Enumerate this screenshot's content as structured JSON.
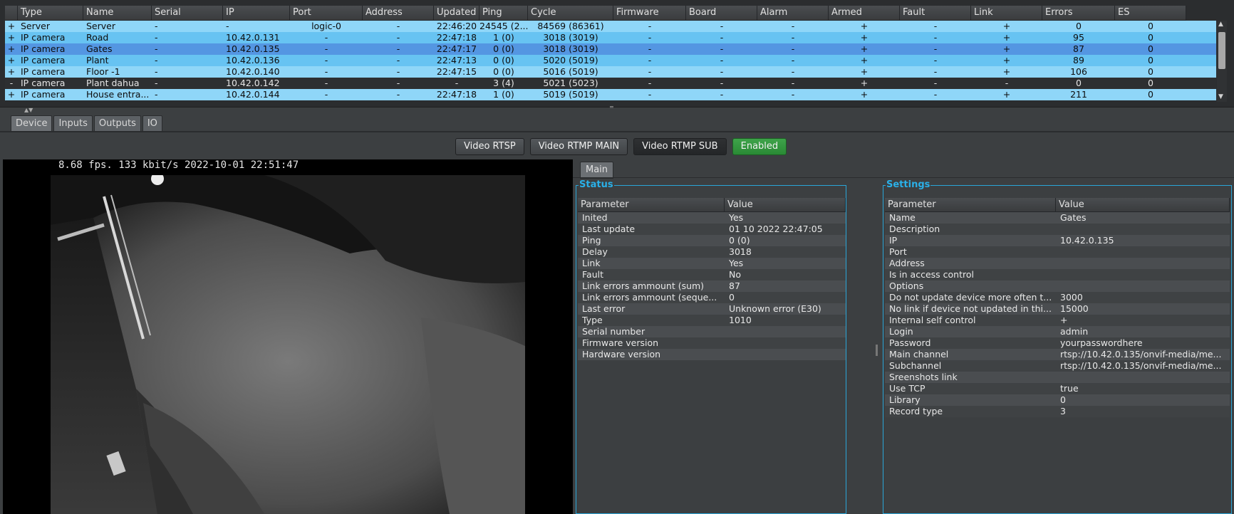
{
  "device_table": {
    "columns": [
      "",
      "Type",
      "Name",
      "Serial",
      "IP",
      "Port",
      "Address",
      "Updated",
      "Ping",
      "Cycle",
      "Firmware",
      "Board",
      "Alarm",
      "Armed",
      "Fault",
      "Link",
      "Errors",
      "ES"
    ],
    "rows": [
      {
        "exp": "+",
        "type": "Server",
        "name": "Server",
        "serial": "-",
        "ip": "-",
        "port": "logic-0",
        "address": "-",
        "updated": "22:46:20",
        "ping": "24545 (2...",
        "cycle": "84569 (86361)",
        "firmware": "-",
        "board": "-",
        "alarm": "-",
        "armed": "+",
        "fault": "-",
        "link": "+",
        "errors": "0",
        "es": "0"
      },
      {
        "exp": "+",
        "type": "IP camera",
        "name": "Road",
        "serial": "-",
        "ip": "10.42.0.131",
        "port": "-",
        "address": "-",
        "updated": "22:47:18",
        "ping": "1 (0)",
        "cycle": "3018 (3019)",
        "firmware": "-",
        "board": "-",
        "alarm": "-",
        "armed": "+",
        "fault": "-",
        "link": "+",
        "errors": "95",
        "es": "0"
      },
      {
        "exp": "+",
        "type": "IP camera",
        "name": "Gates",
        "serial": "-",
        "ip": "10.42.0.135",
        "port": "-",
        "address": "-",
        "updated": "22:47:17",
        "ping": "0 (0)",
        "cycle": "3018 (3019)",
        "firmware": "-",
        "board": "-",
        "alarm": "-",
        "armed": "+",
        "fault": "-",
        "link": "+",
        "errors": "87",
        "es": "0"
      },
      {
        "exp": "+",
        "type": "IP camera",
        "name": "Plant",
        "serial": "-",
        "ip": "10.42.0.136",
        "port": "-",
        "address": "-",
        "updated": "22:47:13",
        "ping": "0 (0)",
        "cycle": "5020 (5019)",
        "firmware": "-",
        "board": "-",
        "alarm": "-",
        "armed": "+",
        "fault": "-",
        "link": "+",
        "errors": "89",
        "es": "0"
      },
      {
        "exp": "+",
        "type": "IP camera",
        "name": "Floor -1",
        "serial": "-",
        "ip": "10.42.0.140",
        "port": "-",
        "address": "-",
        "updated": "22:47:15",
        "ping": "0 (0)",
        "cycle": "5016 (5019)",
        "firmware": "-",
        "board": "-",
        "alarm": "-",
        "armed": "+",
        "fault": "-",
        "link": "+",
        "errors": "106",
        "es": "0"
      },
      {
        "exp": "-",
        "type": "IP camera",
        "name": "Plant dahua",
        "serial": "-",
        "ip": "10.42.0.142",
        "port": "-",
        "address": "-",
        "updated": "-",
        "ping": "3 (4)",
        "cycle": "5021 (5023)",
        "firmware": "-",
        "board": "-",
        "alarm": "-",
        "armed": "+",
        "fault": "-",
        "link": "-",
        "errors": "0",
        "es": "0"
      },
      {
        "exp": "+",
        "type": "IP camera",
        "name": "House entra...",
        "serial": "-",
        "ip": "10.42.0.144",
        "port": "-",
        "address": "-",
        "updated": "22:47:18",
        "ping": "1 (0)",
        "cycle": "5019 (5019)",
        "firmware": "-",
        "board": "-",
        "alarm": "-",
        "armed": "+",
        "fault": "-",
        "link": "+",
        "errors": "211",
        "es": "0"
      }
    ]
  },
  "tabs": [
    "Device",
    "Inputs",
    "Outputs",
    "IO"
  ],
  "streams": {
    "rtsp": "Video RTSP",
    "rtmp_main": "Video RTMP MAIN",
    "rtmp_sub": "Video RTMP SUB",
    "enabled": "Enabled"
  },
  "video": {
    "osd": "8.68 fps.   133 kbit/s 2022-10-01 22:51:47"
  },
  "main_tab": "Main",
  "status": {
    "title": "Status",
    "col_param": "Parameter",
    "col_value": "Value",
    "rows": [
      [
        "Inited",
        "Yes"
      ],
      [
        "Last update",
        "01 10 2022 22:47:05"
      ],
      [
        "Ping",
        "0 (0)"
      ],
      [
        "Delay",
        "3018"
      ],
      [
        "Link",
        "Yes"
      ],
      [
        "Fault",
        "No"
      ],
      [
        "Link errors ammount (sum)",
        "87"
      ],
      [
        "Link errors ammount (seque...",
        "0"
      ],
      [
        "Last error",
        "Unknown error (E30)"
      ],
      [
        "Type",
        "1010"
      ],
      [
        "Serial number",
        ""
      ],
      [
        "Firmware version",
        ""
      ],
      [
        "Hardware version",
        ""
      ]
    ]
  },
  "settings": {
    "title": "Settings",
    "col_param": "Parameter",
    "col_value": "Value",
    "rows": [
      [
        "Name",
        "Gates"
      ],
      [
        "Description",
        ""
      ],
      [
        "IP",
        "10.42.0.135"
      ],
      [
        "Port",
        ""
      ],
      [
        "Address",
        ""
      ],
      [
        "Is in access control",
        ""
      ],
      [
        "Options",
        ""
      ],
      [
        "Do not update device more often t...",
        "3000"
      ],
      [
        "No link if device not updated in thi...",
        "15000"
      ],
      [
        "Internal self control",
        "+"
      ],
      [
        "Login",
        "admin"
      ],
      [
        "Password",
        "yourpasswordhere"
      ],
      [
        "Main channel",
        "rtsp://10.42.0.135/onvif-media/me..."
      ],
      [
        "Subchannel",
        "rtsp://10.42.0.135/onvif-media/me..."
      ],
      [
        "Sreenshots link",
        ""
      ],
      [
        "Use TCP",
        "true"
      ],
      [
        "Library",
        "0"
      ],
      [
        "Record type",
        "3"
      ]
    ]
  }
}
